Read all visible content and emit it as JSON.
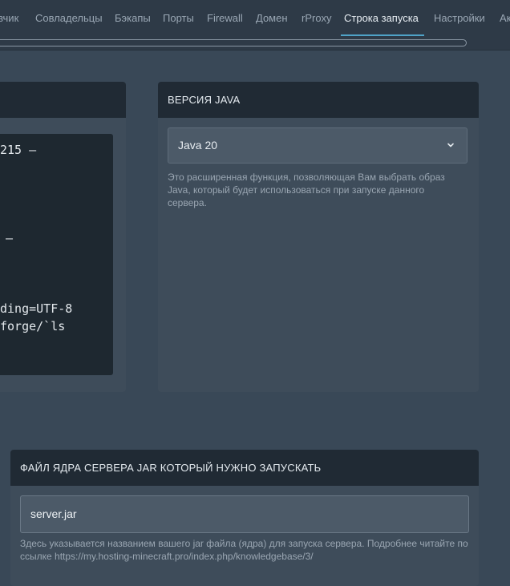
{
  "tabs": [
    {
      "label": "зчик",
      "active": false
    },
    {
      "label": "Совладельцы",
      "active": false
    },
    {
      "label": "Бэкапы",
      "active": false
    },
    {
      "label": "Порты",
      "active": false
    },
    {
      "label": "Firewall",
      "active": false
    },
    {
      "label": "Домен",
      "active": false
    },
    {
      "label": "rProxy",
      "active": false
    },
    {
      "label": "Строка запуска",
      "active": true
    },
    {
      "label": "Настройки",
      "active": false
    },
    {
      "label": "Ак",
      "active": false
    }
  ],
  "startup_command": {
    "lines": [
      "215 –",
      "–",
      "ding=UTF-8",
      "forge/`ls"
    ]
  },
  "java_version": {
    "title": "ВЕРСИЯ JAVA",
    "selected": "Java 20",
    "help": "Это расширенная функция, позволяющая Вам выбрать образ Java, который будет использоваться при запуске данного сервера."
  },
  "server_jar": {
    "title": "ФАЙЛ ЯДРА СЕРВЕРА JAR КОТОРЫЙ НУЖНО ЗАПУСКАТЬ",
    "value": "server.jar",
    "help": "Здесь указывается названием вашего jar файла (ядра) для запуска сервера. Подробнее читайте по ссылке https://my.hosting-minecraft.pro/index.php/knowledgebase/3/"
  },
  "colors": {
    "accent": "#4fa3c7",
    "page_background": "#394857",
    "panel_header": "#202a34"
  }
}
